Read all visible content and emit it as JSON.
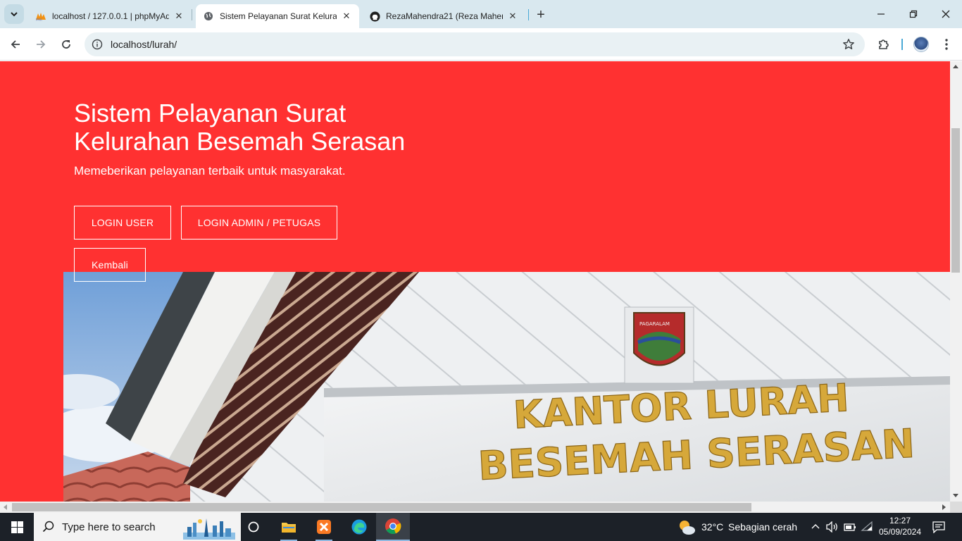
{
  "browser": {
    "tabs": [
      {
        "title": "localhost / 127.0.0.1 | phpMyAdmin",
        "favicon": "phpmyadmin-icon",
        "active": false
      },
      {
        "title": "Sistem Pelayanan Surat Kelurahan",
        "favicon": "globe-icon",
        "active": true
      },
      {
        "title": "RezaMahendra21 (Reza Mahendra)",
        "favicon": "github-icon",
        "active": false
      }
    ],
    "url": "localhost/lurah/",
    "icons": {
      "tab_search": "chevron-down-icon",
      "new_tab": "plus-icon",
      "back": "arrow-left-icon",
      "forward": "arrow-right-icon",
      "reload": "reload-icon",
      "site_info": "info-icon",
      "bookmark": "star-icon",
      "extensions": "puzzle-icon",
      "menu": "kebab-menu-icon"
    }
  },
  "page": {
    "background_color": "#ff3131",
    "hero": {
      "title_line1": "Sistem Pelayanan Surat",
      "title_line2": "Kelurahan Besemah Serasan",
      "subtitle": "Memeberikan pelayanan terbaik untuk masyarakat."
    },
    "buttons": {
      "login_user": "LOGIN USER",
      "login_admin": "LOGIN ADMIN / PETUGAS",
      "kembali": "Kembali"
    },
    "photo": {
      "sign_line1": "KANTOR LURAH",
      "sign_line2": "BESEMAH SERASAN",
      "emblem_text": "PAGARALAM"
    }
  },
  "taskbar": {
    "search_placeholder": "Type here to search",
    "weather": {
      "temp": "32°C",
      "desc": "Sebagian cerah"
    },
    "clock": {
      "time": "12:27",
      "date": "05/09/2024"
    }
  }
}
